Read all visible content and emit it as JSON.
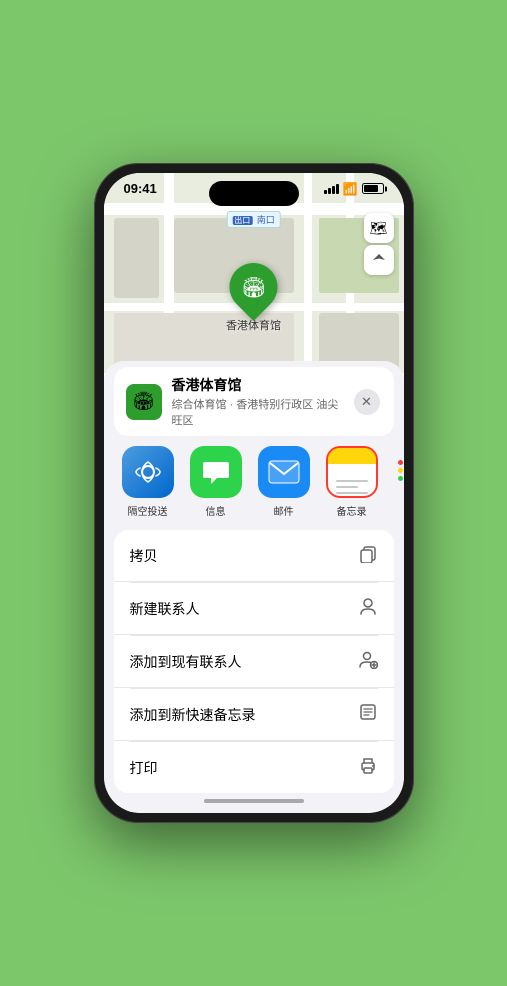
{
  "status_bar": {
    "time": "09:41",
    "navigation_arrow": "▶"
  },
  "map": {
    "label": "南口",
    "pin_label": "香港体育馆",
    "pin_emoji": "🏟️"
  },
  "map_controls": {
    "map_btn_label": "🗺",
    "location_btn_label": "⬆"
  },
  "location_info": {
    "name": "香港体育馆",
    "subtitle": "综合体育馆 · 香港特别行政区 油尖旺区",
    "close_label": "✕",
    "logo_emoji": "🏟️"
  },
  "share_items": [
    {
      "label": "隔空投送",
      "type": "airdrop"
    },
    {
      "label": "信息",
      "type": "messages"
    },
    {
      "label": "邮件",
      "type": "mail"
    },
    {
      "label": "备忘录",
      "type": "notes"
    }
  ],
  "action_items": [
    {
      "label": "拷贝",
      "icon": "copy"
    },
    {
      "label": "新建联系人",
      "icon": "person"
    },
    {
      "label": "添加到现有联系人",
      "icon": "person-add"
    },
    {
      "label": "添加到新快速备忘录",
      "icon": "note"
    },
    {
      "label": "打印",
      "icon": "print"
    }
  ]
}
